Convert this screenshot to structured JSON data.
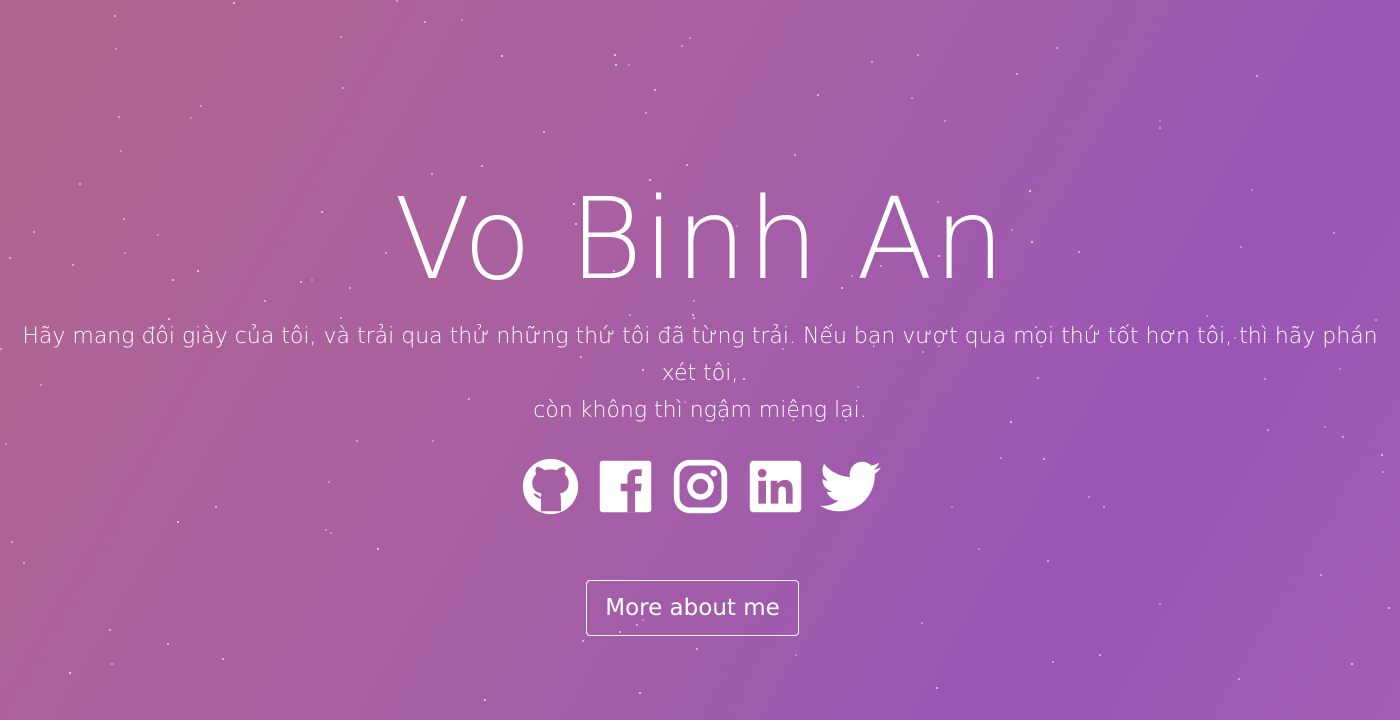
{
  "hero": {
    "title": "Vo Binh An",
    "subtitle_line1": "Hãy mang đôi giày của tôi, và trải qua thử những thứ tôi đã từng trải. Nếu bạn vượt qua mọi thứ tốt hơn tôi, thì hãy phán xét tôi,",
    "subtitle_line2": "còn không thì ngậm miệng lại.",
    "button_label": "More about me"
  },
  "socials": [
    {
      "icon": "github-icon"
    },
    {
      "icon": "facebook-icon"
    },
    {
      "icon": "instagram-icon"
    },
    {
      "icon": "linkedin-icon"
    },
    {
      "icon": "twitter-icon"
    }
  ],
  "colors": {
    "gradient_start": "#b1668f",
    "gradient_end": "#9a56b6",
    "text": "#ffffff"
  }
}
